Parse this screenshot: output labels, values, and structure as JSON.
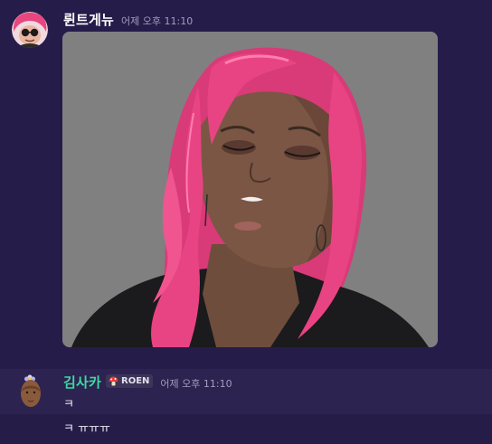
{
  "messages": [
    {
      "author": "륀트게뉴",
      "author_color": "#ffffff",
      "timestamp": "어제 오후 11:10",
      "attachment": {
        "type": "image",
        "subject": "pink-haired 3D avatar with closed eyes"
      }
    },
    {
      "author": "김사카",
      "author_color": "#3fd8a2",
      "role": {
        "icon": "mushroom-icon",
        "label": "ROEN"
      },
      "timestamp": "어제 오후 11:10",
      "lines": [
        "ㅋ",
        "ㅋ ㅠㅠㅠ"
      ]
    }
  ],
  "colors": {
    "background": "#261c4a",
    "hover_row": "#2c2350",
    "timestamp": "#a39dbb"
  }
}
